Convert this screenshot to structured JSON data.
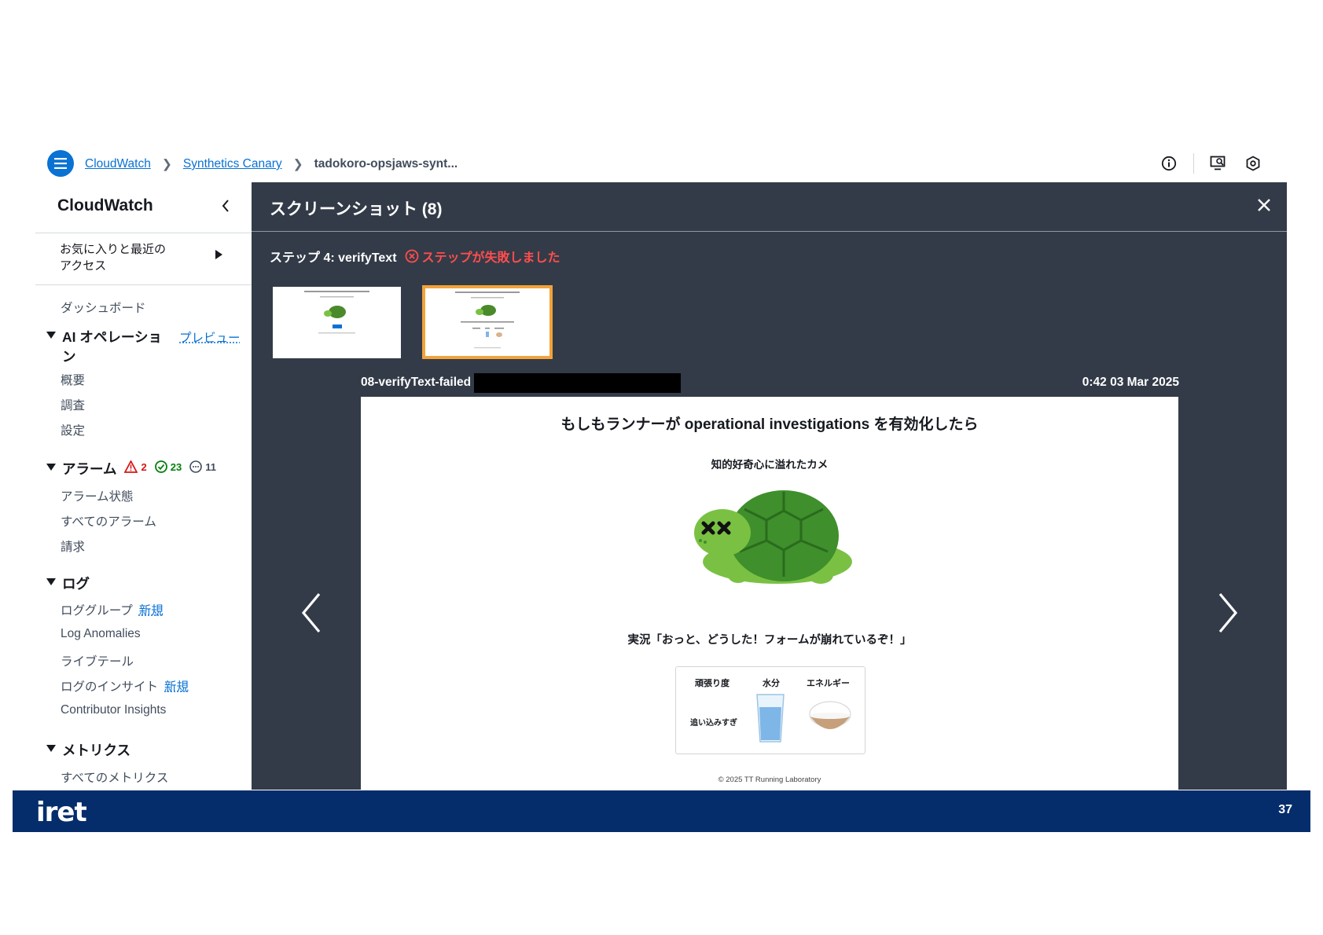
{
  "breadcrumb": {
    "items": [
      "CloudWatch",
      "Synthetics Canary"
    ],
    "current": "tadokoro-opsjaws-synt..."
  },
  "sidebar": {
    "title": "CloudWatch",
    "favorites_line1": "お気に入りと最近の",
    "favorites_line2": "アクセス",
    "dashboard": "ダッシュボード",
    "ai_ops": {
      "title_line1": "AI オペレーショ",
      "title_line2": "ン",
      "preview": "プレビュー",
      "items": [
        "概要",
        "調査",
        "設定"
      ]
    },
    "alarms": {
      "title": "アラーム",
      "alarm_count": "2",
      "ok_count": "23",
      "insufficient_count": "11",
      "items": [
        "アラーム状態",
        "すべてのアラーム",
        "請求"
      ]
    },
    "logs": {
      "title": "ログ",
      "items": [
        "ロググループ",
        "Log Anomalies",
        "ライブテール",
        "ログのインサイト",
        "Contributor Insights"
      ],
      "new_label": "新規"
    },
    "metrics": {
      "title": "メトリクス",
      "items": [
        "すべてのメトリクス"
      ]
    }
  },
  "modal": {
    "title": "スクリーンショット (8)",
    "step": "ステップ 4: verifyText",
    "fail_text": "ステップが失敗しました",
    "caption": "08-verifyText-failed",
    "timestamp": "0:42 03 Mar 2025"
  },
  "screenshot": {
    "title": "もしもランナーが operational investigations を有効化したら",
    "subtitle": "知的好奇心に溢れたカメ",
    "status": "実況「おっと、どうした！フォームが崩れているぞ！」",
    "card_headers": [
      "頑張り度",
      "水分",
      "エネルギー"
    ],
    "card_label": "追い込みすぎ",
    "copyright": "© 2025 TT Running Laboratory"
  },
  "footer": {
    "logo": "iret",
    "page": "37"
  },
  "colors": {
    "accent": "#0972d3",
    "modal_bg": "#333b48",
    "footer_bg": "#052d6c",
    "error": "#ff4d4d",
    "selected_border": "#f2a33a",
    "turtle_green": "#5aa832"
  }
}
